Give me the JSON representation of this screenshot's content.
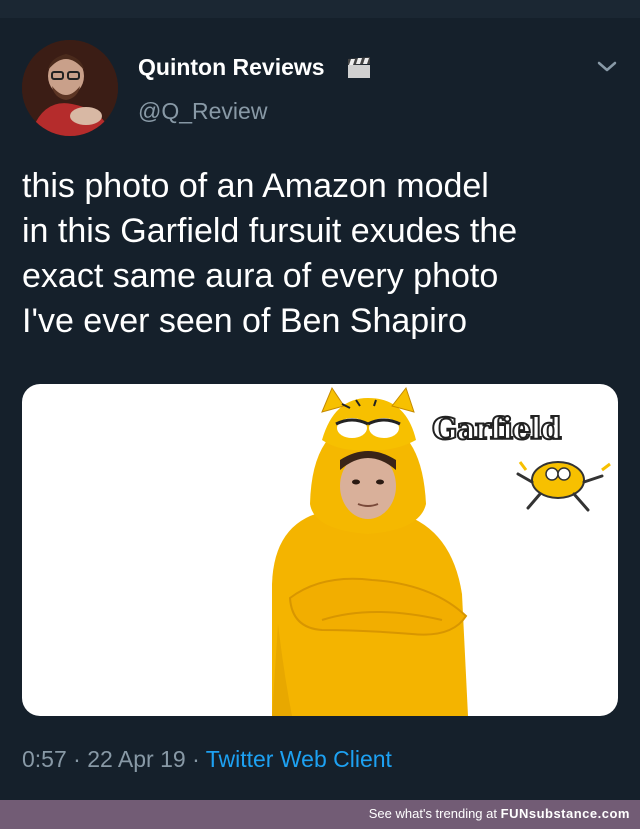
{
  "tweet": {
    "display_name": "Quinton Reviews",
    "badge_icon": "clapperboard-icon",
    "handle": "@Q_Review",
    "menu_icon": "chevron-down-icon",
    "text": "this photo of an Amazon model\nin this Garfield fursuit exudes the\nexact same aura of every photo\nI've ever seen of Ben Shapiro",
    "media": {
      "logo_text": "Garfield"
    },
    "time": "0:57",
    "date": "22 Apr 19",
    "separator": "·",
    "client": "Twitter Web Client"
  },
  "footer": {
    "prefix": "See what's trending at",
    "brand": "FUNsubstance.com"
  },
  "colors": {
    "background": "#15202b",
    "muted": "#8899a6",
    "link": "#1da1f2",
    "footer": "#725c75",
    "garfield": "#f5b800"
  }
}
